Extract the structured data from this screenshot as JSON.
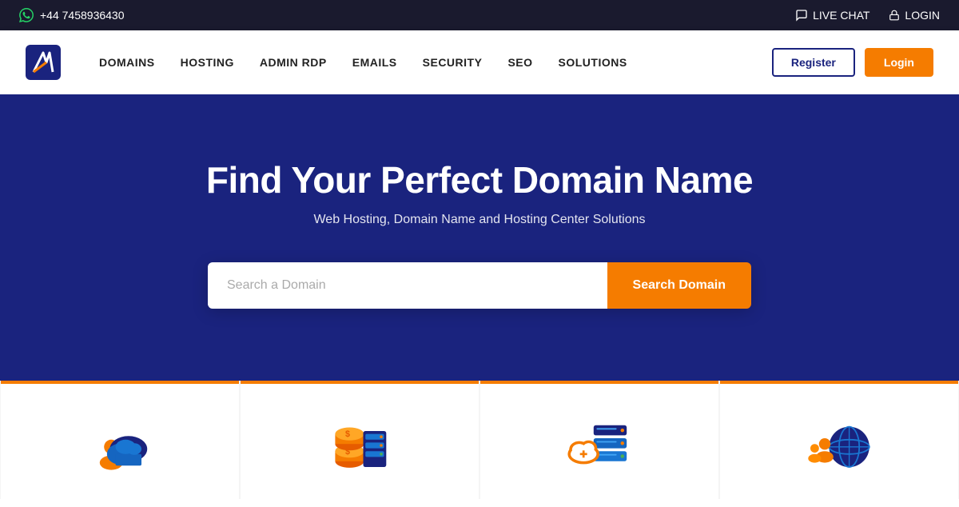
{
  "topbar": {
    "phone": "+44 7458936430",
    "live_chat": "LIVE CHAT",
    "login": "LOGIN"
  },
  "navbar": {
    "logo_alt": "Logo",
    "links": [
      {
        "label": "DOMAINS"
      },
      {
        "label": "HOSTING"
      },
      {
        "label": "ADMIN RDP"
      },
      {
        "label": "EMAILS"
      },
      {
        "label": "SECURITY"
      },
      {
        "label": "SEO"
      },
      {
        "label": "SOLUTIONS"
      }
    ],
    "register_label": "Register",
    "login_label": "Login"
  },
  "hero": {
    "heading": "Find Your Perfect Domain Name",
    "subheading": "Web Hosting, Domain Name and Hosting Center Solutions",
    "search_placeholder": "Search a Domain",
    "search_button": "Search Domain"
  },
  "cards": [
    {
      "id": "card-1",
      "icon": "cloud-person-icon"
    },
    {
      "id": "card-2",
      "icon": "coin-server-icon"
    },
    {
      "id": "card-3",
      "icon": "cloud-server-icon"
    },
    {
      "id": "card-4",
      "icon": "globe-people-icon"
    }
  ],
  "colors": {
    "accent_orange": "#f57c00",
    "dark_blue": "#1a237e",
    "top_bar_bg": "#1a1a2e"
  }
}
